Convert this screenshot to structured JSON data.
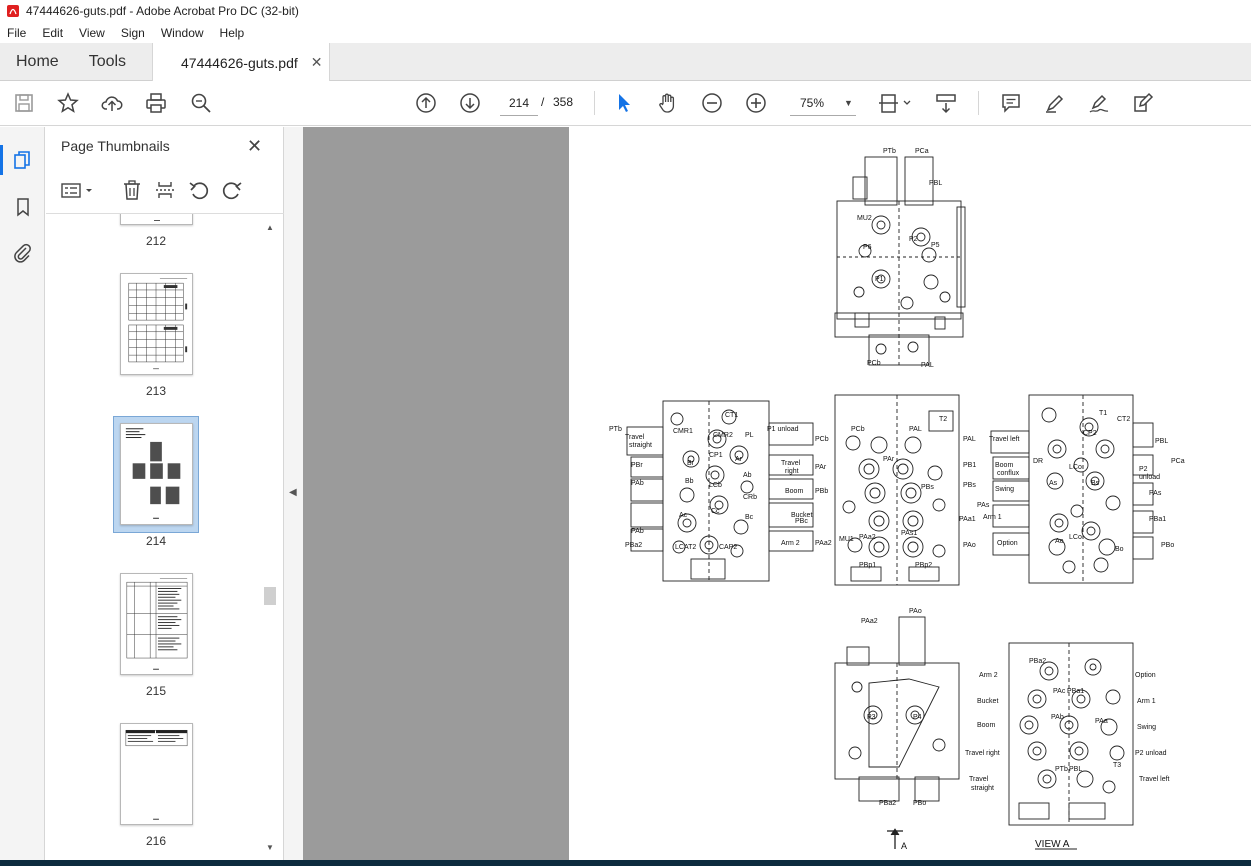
{
  "window": {
    "title": "47444626-guts.pdf - Adobe Acrobat Pro DC (32-bit)",
    "menu": [
      "File",
      "Edit",
      "View",
      "Sign",
      "Window",
      "Help"
    ]
  },
  "tabs": {
    "home": "Home",
    "tools": "Tools",
    "document": "47444626-guts.pdf"
  },
  "toolbar": {
    "current_page": "214",
    "page_separator": "/",
    "total_pages": "358",
    "zoom": "75%"
  },
  "thumbnails": {
    "title": "Page Thumbnails",
    "items": [
      {
        "label": "212"
      },
      {
        "label": "213"
      },
      {
        "label": "214",
        "selected": true
      },
      {
        "label": "215"
      },
      {
        "label": "216"
      }
    ]
  },
  "drawing": {
    "upper_labels": [
      "PTb",
      "PCa",
      "PBL",
      "MU2",
      "P6",
      "P2",
      "P5",
      "P1",
      "PCb",
      "PAL"
    ],
    "left_labels": [
      "PTb",
      "Travel straight",
      "CMR1",
      "CMR2",
      "CT1",
      "PL",
      "P1 unload",
      "PCb",
      "PBr",
      "Br",
      "CP1",
      "Ar",
      "Travel right",
      "PAr",
      "PAb",
      "Bb",
      "LCb",
      "Ab",
      "Boom",
      "PBb",
      "PAb",
      "Ac",
      "Cc",
      "CRb",
      "Bucket",
      "PBc",
      "Bc",
      "Arm 2",
      "PAa2",
      "PBa2",
      "LCAT2",
      "CAP2"
    ],
    "center_labels": [
      "T2",
      "PCb",
      "PAL",
      "PAr",
      "PBs",
      "PAs1",
      "MU1",
      "PAa2",
      "PBp1",
      "PBp2"
    ],
    "right_labels": [
      "T1",
      "CT2",
      "PAL",
      "Travel left",
      "PBL",
      "CP2",
      "PB1",
      "Boom conflux",
      "DR",
      "LCo",
      "P2 unload",
      "PCa",
      "PBs",
      "Swing",
      "As",
      "Bs",
      "PAs",
      "PBa1",
      "PAs",
      "Arm 1",
      "Ao",
      "PBa1",
      "PAo",
      "Option",
      "LCo",
      "Bo",
      "PBo"
    ],
    "lower_left_labels": [
      "PAa2",
      "PAo",
      "P3",
      "P4",
      "PBa2",
      "PBo",
      "A"
    ],
    "view_a_labels": [
      "PBa2",
      "Arm 2",
      "Option",
      "Bucket",
      "PAc",
      "PBa1",
      "Arm 1",
      "Boom",
      "PAb",
      "PAa",
      "Swing",
      "Travel right",
      "P2 unload",
      "Travel straight",
      "PTb",
      "PBL",
      "T3",
      "Travel left"
    ],
    "view_title": "VIEW A"
  }
}
